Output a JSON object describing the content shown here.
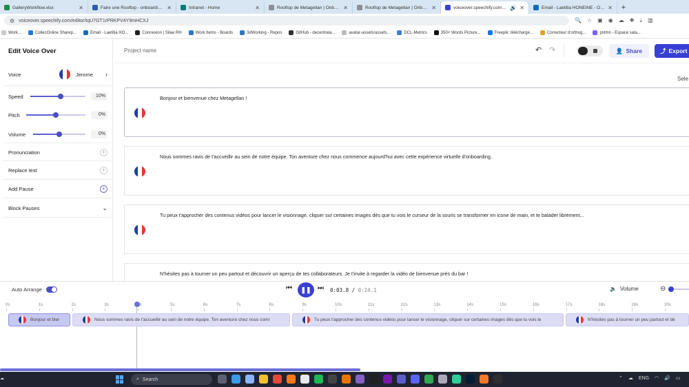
{
  "browser": {
    "tabs": [
      {
        "title": "GalleryWorkflow.xlsx",
        "active": false
      },
      {
        "title": "Faire une Rooftop - onboarding...",
        "active": false
      },
      {
        "title": "Intranet - Home",
        "active": false
      },
      {
        "title": "Rooftop de Metagellan | Onboa...",
        "active": false
      },
      {
        "title": "Rooftop de Metagellan | Onboa...",
        "active": false
      },
      {
        "title": "voiceover.speechify.com/edit...",
        "active": true
      },
      {
        "title": "Email - Laetitia HONEINE - Outl...",
        "active": false
      }
    ],
    "new_tab": "+",
    "url": "voiceover.speechify.com/editor/tqU7GT1rPRKPV4Y9mHCXJ",
    "bookmarks": [
      {
        "label": "Work...",
        "color": "#c9c9c9"
      },
      {
        "label": "CollecOnline Sharep...",
        "color": "#1f7bd6"
      },
      {
        "label": "Email - Laetitia HO...",
        "color": "#0f6cbd"
      },
      {
        "label": "Connexion | Silae RH",
        "color": "#222222"
      },
      {
        "label": "Work Items - Boards",
        "color": "#2d77c5"
      },
      {
        "label": "3dWorking - Repos",
        "color": "#2d77c5"
      },
      {
        "label": "GitHub - decentrala...",
        "color": "#333333"
      },
      {
        "label": "avatar-assets/assets...",
        "color": "#bbbbbb"
      },
      {
        "label": "DCL-Metrics",
        "color": "#3b7dd8"
      },
      {
        "label": "350+ Words Picture...",
        "color": "#111111"
      },
      {
        "label": "Freepik: télécharge...",
        "color": "#1273eb"
      },
      {
        "label": "Correcteur d'orthog...",
        "color": "#d9a52b"
      },
      {
        "label": "pstmn - Espace sala...",
        "color": "#7b61ff"
      }
    ]
  },
  "left_panel": {
    "title": "Edit Voice Over",
    "voice_label": "Voice",
    "voice_name": "Jerome",
    "speed_label": "Speed",
    "speed_value": "10%",
    "speed_level": 0.55,
    "pitch_label": "Pitch",
    "pitch_value": "0%",
    "pitch_level": 0.5,
    "volume_label": "Volume",
    "volume_value": "0%",
    "volume_level": 0.5,
    "pronunciation_label": "Pronunciation",
    "replace_text_label": "Replace text",
    "add_pause_label": "Add Pause",
    "block_pauses_label": "Block Pauses"
  },
  "topbar": {
    "project_name": "Project name",
    "share_label": "Share",
    "export_label": "Export",
    "select_hint": "Sele"
  },
  "blocks": [
    {
      "text": "Bonjour et bienvenue chez Metagellan !",
      "selected": true
    },
    {
      "text": "Nous sommes ravis de t'accueillir au sein de notre équipe. Ton aventure chez nous commence aujourd'hui avec cette expérience virtuelle d'onboarding.",
      "selected": false
    },
    {
      "text": "Tu peux t'approcher des contenus vidéos pour lancer le visionnage, cliquer sur certaines images dès que tu vois le curseur de la souris se transformer en icone de main, et te balader librement...",
      "selected": false
    },
    {
      "text": "N'hésites pas à tourner un peu partout et découvrir un aperçu de tes collaborateurs. Je t'invite à regarder la vidéo de bienvenue près du bar !",
      "selected": false
    }
  ],
  "player": {
    "auto_arrange_label": "Auto Arrange",
    "time_current": "0:03.8",
    "time_sep": "/",
    "time_total": "0:24.1",
    "volume_label": "Volume"
  },
  "ruler_ticks": [
    "0s",
    "1s",
    "2s",
    "3s",
    "4s",
    "5s",
    "6s",
    "7s",
    "8s",
    "9s",
    "10s",
    "11s",
    "12s",
    "13s",
    "14s",
    "15s",
    "16s",
    "17s",
    "18s",
    "19s",
    "20s"
  ],
  "clips": [
    {
      "text": "Bonjour et bier"
    },
    {
      "text": "Nous sommes ravis de t'accueillir au sein de notre équipe. Ton aventure chez nous comr"
    },
    {
      "text": "Tu peux t'approcher des contenus vidéos pour lancer le visionnage, cliquer sur certaines images dès que tu vois le"
    },
    {
      "text": "N'hésites pas à tourner un peu partout et dé"
    }
  ],
  "taskbar": {
    "search_label": "Search",
    "language": "ENG",
    "weather": "☁︎"
  },
  "colors": {
    "accent": "#3b40d4",
    "accent_light": "#dcdcf5",
    "tab_bar": "#d8e6f3",
    "taskbar": "#1f2430"
  }
}
